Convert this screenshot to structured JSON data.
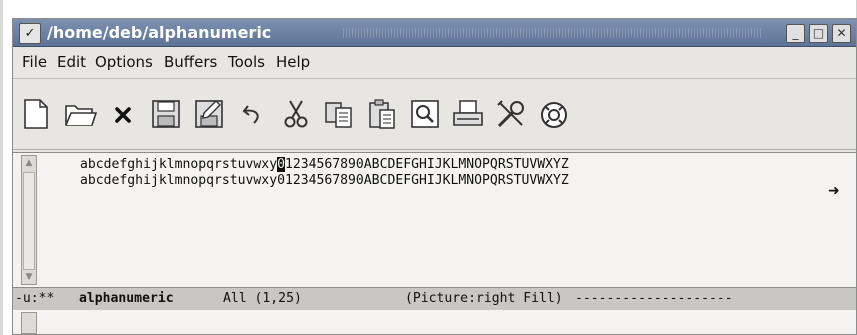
{
  "window": {
    "title": "/home/deb/alphanumeric",
    "menu_glyph": "✓",
    "minimize_glyph": "_",
    "maximize_glyph": "□",
    "close_glyph": "✕"
  },
  "menubar": {
    "items": [
      "File",
      "Edit",
      "Options",
      "Buffers",
      "Tools",
      "Help"
    ]
  },
  "toolbar": {
    "icons": [
      "new-file-icon",
      "open-folder-icon",
      "close-buffer-icon",
      "save-icon",
      "save-as-icon",
      "undo-icon",
      "cut-icon",
      "copy-icon",
      "paste-icon",
      "search-icon",
      "print-icon",
      "customize-icon",
      "help-icon"
    ]
  },
  "editor": {
    "line1_before_cursor": "abcdefghijklmnopqrstuvwxy",
    "cursor_char": "0",
    "line1_after_cursor": "1234567890ABCDEFGHIJKLMNOPQRSTUVWXYZ",
    "line2": "abcdefghijklmnopqrstuvwxy01234567890ABCDEFGHIJKLMNOPQRSTUVWXYZ",
    "wrap_indicator": "➜"
  },
  "modeline": {
    "status": "-u:**",
    "buffer_name": "alphanumeric",
    "position": "All (1,25)",
    "modes": "(Picture:right Fill)",
    "dashes": "--------------------"
  },
  "colors": {
    "titlebar": "#6b81a3",
    "window_bg": "#e8e6e3",
    "text": "#111111"
  }
}
